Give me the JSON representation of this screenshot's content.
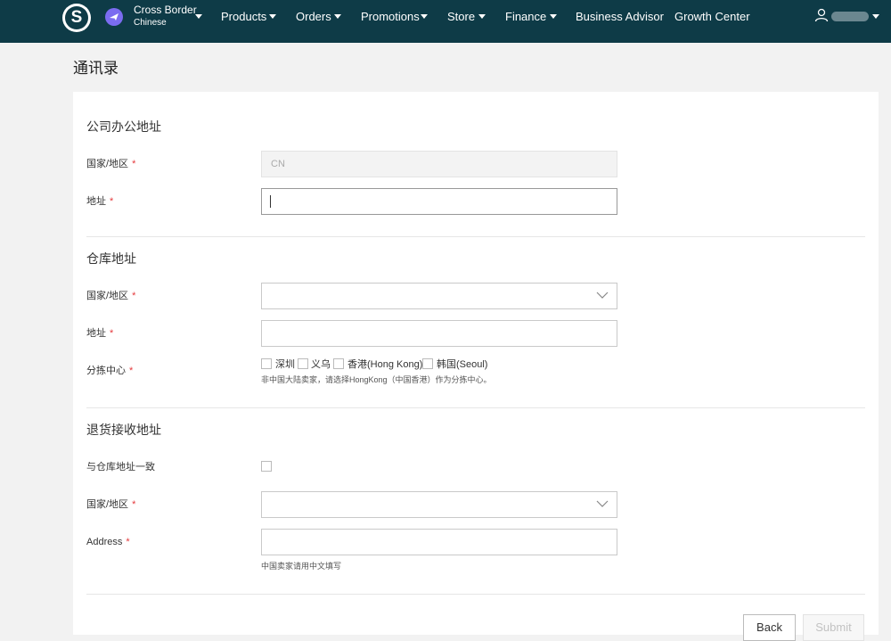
{
  "nav": {
    "logo_letter": "S",
    "site_name": "Cross Border",
    "site_sub": "Chinese",
    "items": [
      {
        "label": "Products",
        "has_menu": true
      },
      {
        "label": "Orders",
        "has_menu": true
      },
      {
        "label": "Promotions",
        "has_menu": true
      },
      {
        "label": "Store",
        "has_menu": true
      },
      {
        "label": "Finance",
        "has_menu": true
      },
      {
        "label": "Business Advisor",
        "has_menu": false
      },
      {
        "label": "Growth Center",
        "has_menu": false
      }
    ],
    "user_icon": "user-icon",
    "colors": {
      "bar": "#0e3b47",
      "site_icon": "#7b6cf0"
    }
  },
  "page": {
    "title": "通讯录"
  },
  "office": {
    "title": "公司办公地址",
    "country_label": "国家/地区",
    "country_value": "CN",
    "address_label": "地址",
    "address_value": ""
  },
  "warehouse": {
    "title": "仓库地址",
    "country_label": "国家/地区",
    "address_label": "地址",
    "sorting_label": "分拣中心",
    "sorting_options": [
      "深圳",
      "义乌",
      "香港(Hong Kong)",
      "韩国(Seoul)"
    ],
    "sorting_hint": "非中国大陆卖家，请选择HongKong（中国香港）作为分拣中心。"
  },
  "returns": {
    "title": "退货接收地址",
    "same_label": "与仓库地址一致",
    "country_label": "国家/地区",
    "address_label": "Address",
    "address_hint": "中国卖家请用中文填写"
  },
  "required_mark": "*",
  "actions": {
    "back": "Back",
    "submit": "Submit"
  },
  "colors": {
    "required": "#e4393c",
    "background": "#f2f2f2"
  }
}
